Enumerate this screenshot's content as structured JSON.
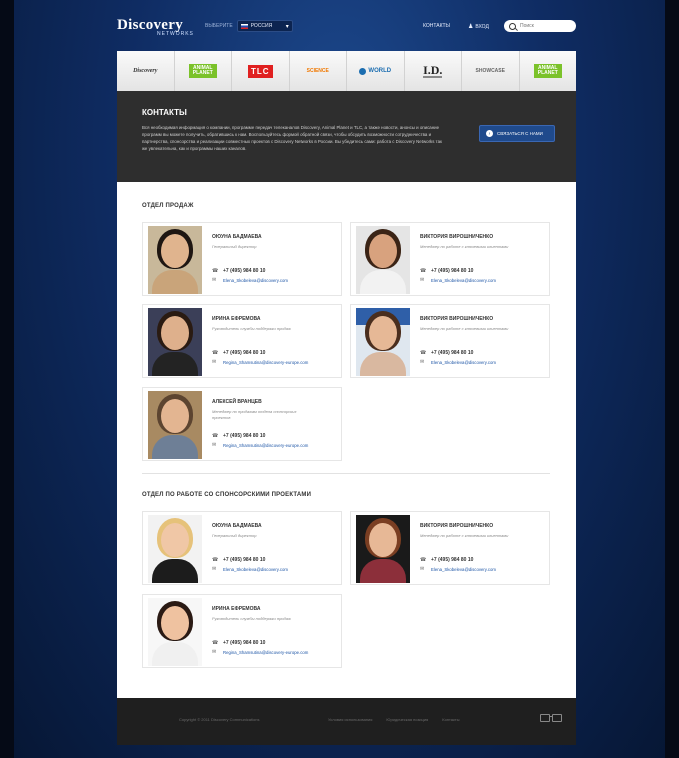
{
  "header": {
    "logo_text": "Discovery",
    "logo_subtext": "NETWORKS",
    "country_label": "ВЫБЕРИТЕ",
    "country_value": "РОССИЯ",
    "links": [
      "КОНТАКТЫ",
      "ВХОД"
    ],
    "search_placeholder": "Поиск"
  },
  "channels": [
    "Discovery",
    "ANIMAL PLANET",
    "TLC",
    "SCIENCE",
    "WORLD",
    "I.D.",
    "SHOWCASE",
    "ANIMAL PLANET"
  ],
  "banner": {
    "title": "КОНТАКТЫ",
    "text": "Вся необходимая информация о компании, программе передач телеканалов Discovery, Animal Planet и TLC, а также новости, анонсы и описание программ вы можете получить, обратившись к нам. Воспользуйтесь формой обратной связи, чтобы обсудить возможности сотрудничества и партнерства, спонсорства и реализации совместных проектов с Discovery Networks в России. Вы убедитесь сами: работа с Discovery Networks так же увлекательна, как и программы наших каналов.",
    "button_label": "СВЯЗАТЬСЯ С НАМИ"
  },
  "sales": {
    "title": "ОТДЕЛ ПРОДАЖ",
    "contacts": [
      {
        "name": "ОЮУНА БАДМАЕВА",
        "role": "Генеральный директор",
        "phone": "+7 (495) 984 80 10",
        "email": "Elena_Skobeleva@discovery.com"
      },
      {
        "name": "ВИКТОРИЯ ВИРОШНИЧЕНКО",
        "role": "Менеджер по работе с ключевыми клиентами",
        "phone": "+7 (495) 984 80 10",
        "email": "Elena_Skobeleva@discovery.com"
      },
      {
        "name": "ИРИНА ЕФРЕМОВА",
        "role": "Руководитель службы поддержки продаж",
        "phone": "+7 (495) 984 80 10",
        "email": "Regina_Shamsutina@discovery-europe.com"
      },
      {
        "name": "ВИКТОРИЯ ВИРОШНИЧЕНКО",
        "role": "Менеджер по работе с ключевыми клиентами",
        "phone": "+7 (495) 984 80 10",
        "email": "Elena_Skobeleva@discovery.com"
      },
      {
        "name": "АЛЕКСЕЙ ВРАНЦЕВ",
        "role": "Менеджер по продажам отдела спонсорских проектов",
        "phone": "+7 (495) 984 80 10",
        "email": "Regina_Shamsutina@discovery-europe.com"
      }
    ]
  },
  "sponsor": {
    "title": "ОТДЕЛ ПО РАБОТЕ СО СПОНСОРСКИМИ ПРОЕКТАМИ",
    "contacts": [
      {
        "name": "ОЮУНА БАДМАЕВА",
        "role": "Генеральный директор",
        "phone": "+7 (495) 984 80 10",
        "email": "Elena_Skobeleva@discovery.com"
      },
      {
        "name": "ВИКТОРИЯ ВИРОШНИЧЕНКО",
        "role": "Менеджер по работе с ключевыми клиентами",
        "phone": "+7 (495) 984 80 10",
        "email": "Elena_Skobeleva@discovery.com"
      },
      {
        "name": "ИРИНА ЕФРЕМОВА",
        "role": "Руководитель службы поддержки продаж",
        "phone": "+7 (495) 984 80 10",
        "email": "Regina_Shamsutina@discovery-europe.com"
      }
    ]
  },
  "footer": {
    "copyright": "Copyright © 2011 Discovery Communications",
    "links": [
      "Условия использования",
      "Юридическая позиция",
      "Контакты"
    ]
  },
  "colors": {
    "accent": "#1f4a8c",
    "background": "#0f2c63",
    "banner": "#2e2e2e",
    "link": "#1d55a6"
  }
}
